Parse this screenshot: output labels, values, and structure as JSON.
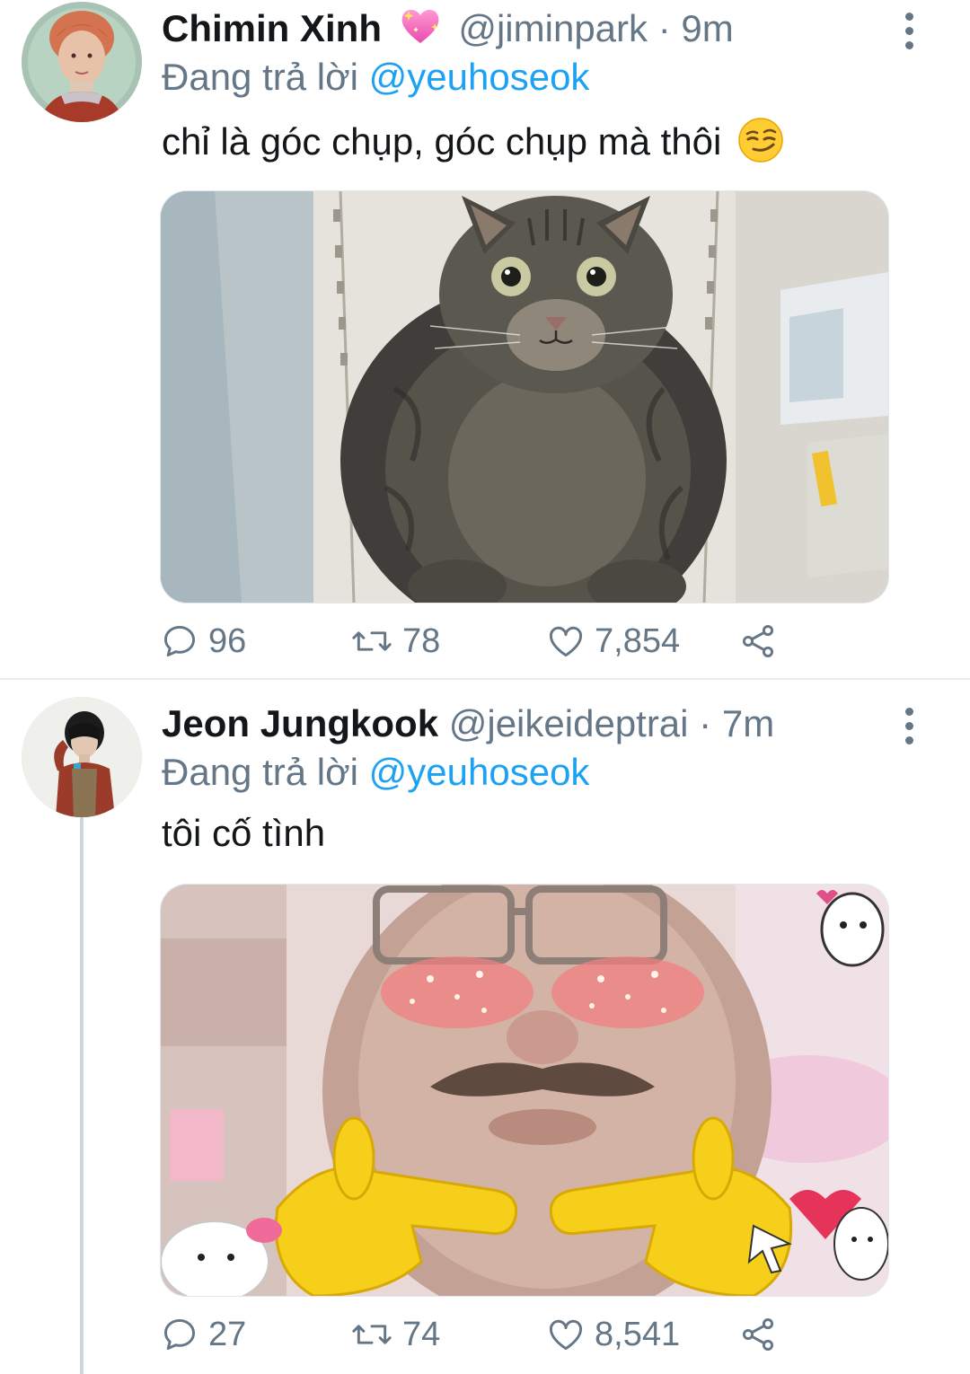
{
  "tweets": [
    {
      "display_name": "Chimin Xinh",
      "name_emoji": "sparkling-heart-emoji",
      "handle": "@jiminpark",
      "separator": "·",
      "time": "9m",
      "reply_prefix": "Đang trả lời",
      "reply_to": "@yeuhoseok",
      "text": "chỉ là góc chụp, góc chụp mà thôi",
      "text_emoji": "smirking-face-emoji",
      "media": "photo of a fat tabby cat sitting in an open refrigerator",
      "replies": "96",
      "retweets": "78",
      "likes": "7,854"
    },
    {
      "display_name": "Jeon Jungkook",
      "handle": "@jeikeideptrai",
      "separator": "·",
      "time": "7m",
      "reply_prefix": "Đang trả lời",
      "reply_to": "@yeuhoseok",
      "text": "tôi cố tình",
      "media": "meme photo of a mustached man with glasses, sparkle blush stickers and yellow pointing-finger hands",
      "replies": "27",
      "retweets": "74",
      "likes": "8,541"
    }
  ],
  "colors": {
    "link": "#1da1f2",
    "secondary_text": "#657786",
    "primary_text": "#14171a",
    "divider": "#e6ecf0"
  },
  "icons": [
    "reply-icon",
    "retweet-icon",
    "like-icon",
    "share-icon",
    "more-icon"
  ]
}
